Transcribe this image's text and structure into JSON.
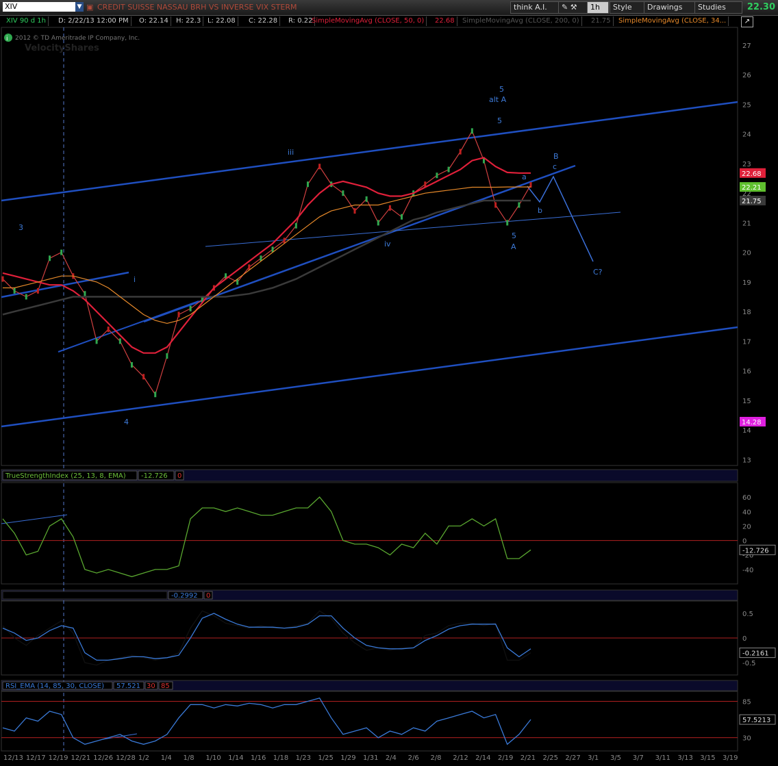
{
  "toolbar": {
    "symbol": "XIV",
    "description": "CREDIT SUISSE NASSAU BRH VS INVERSE VIX STERM",
    "think_label": "think A.I.",
    "interval_label": "1h",
    "style_label": "Style",
    "drawings_label": "Drawings",
    "studies_label": "Studies",
    "last_price": "22.30"
  },
  "quote": {
    "symbol_period": "XIV 90 d 1h",
    "date": "D: 2/22/13 12:00 PM",
    "open": "O: 22.14",
    "high": "H: 22.3",
    "low": "L: 22.08",
    "close": "C: 22.28",
    "range": "R: 0.22",
    "sma50": "SimpleMovingAvg (CLOSE, 50, 0)",
    "sma50_val": "22.68",
    "sma200": "SimpleMovingAvg (CLOSE, 200, 0)",
    "sma200_val": "21.75",
    "sma34": "SimpleMovingAvg (CLOSE, 34...",
    "copyright": "2012 © TD Ameritrade IP Company, Inc.",
    "watermark": "VelocityShares"
  },
  "chart_data": [
    {
      "type": "line",
      "panel": "price",
      "ylim": [
        12.8,
        27.6
      ],
      "y_ticks": [
        13,
        14,
        15,
        16,
        17,
        18,
        19,
        20,
        21,
        22,
        23,
        24,
        25,
        26,
        27
      ],
      "price_badges": [
        {
          "label": "22.68",
          "value": 22.68,
          "color": "#e0203a"
        },
        {
          "label": "22.21",
          "value": 22.21,
          "color": "#5fbf2f"
        },
        {
          "label": "21.75",
          "value": 21.75,
          "color": "#3a3a3a"
        },
        {
          "label": "14.28",
          "value": 14.28,
          "color": "#e020e0"
        }
      ],
      "x_labels": [
        "12/13",
        "12/17",
        "12/19",
        "12/21",
        "12/26",
        "12/28",
        "1/2",
        "1/4",
        "1/8",
        "1/10",
        "1/14",
        "1/16",
        "1/18",
        "1/23",
        "1/25",
        "1/29",
        "1/31",
        "2/4",
        "2/6",
        "2/8",
        "2/12",
        "2/14",
        "2/19",
        "2/21",
        "2/25",
        "2/27",
        "3/1",
        "3/5",
        "3/7",
        "3/11",
        "3/13",
        "3/15",
        "3/19"
      ],
      "series": [
        {
          "values": [
            19.1,
            18.7,
            18.5,
            18.7,
            19.8,
            20.0,
            19.2,
            18.6,
            17.0,
            17.4,
            17.0,
            16.2,
            15.8,
            15.2,
            16.5,
            17.9,
            18.1,
            18.4,
            18.8,
            19.2,
            19.0,
            19.5,
            19.8,
            20.1,
            20.4,
            20.9,
            22.3,
            22.9,
            22.3,
            22.0,
            21.4,
            21.8,
            21.0,
            21.5,
            21.2,
            22.0,
            22.3,
            22.6,
            22.8,
            23.4,
            24.1,
            23.1,
            21.6,
            21.0,
            21.6,
            22.28
          ]
        },
        {
          "name": "SimpleMovingAvg (CLOSE, 50, 0)",
          "values": [
            19.3,
            19.2,
            19.1,
            19.0,
            18.9,
            18.9,
            18.7,
            18.4,
            18.0,
            17.6,
            17.2,
            16.8,
            16.6,
            16.6,
            16.8,
            17.3,
            17.8,
            18.3,
            18.8,
            19.1,
            19.4,
            19.7,
            20.0,
            20.3,
            20.7,
            21.1,
            21.6,
            22.0,
            22.3,
            22.4,
            22.3,
            22.2,
            22.0,
            21.9,
            21.9,
            22.0,
            22.2,
            22.4,
            22.6,
            22.8,
            23.1,
            23.2,
            22.9,
            22.7,
            22.68,
            22.68
          ]
        },
        {
          "name": "SimpleMovingAvg (CLOSE, 200, 0)",
          "values": [
            17.9,
            18.0,
            18.1,
            18.2,
            18.3,
            18.4,
            18.5,
            18.5,
            18.5,
            18.5,
            18.5,
            18.5,
            18.5,
            18.5,
            18.5,
            18.5,
            18.5,
            18.5,
            18.5,
            18.5,
            18.55,
            18.6,
            18.7,
            18.8,
            18.95,
            19.1,
            19.3,
            19.5,
            19.7,
            19.9,
            20.1,
            20.3,
            20.5,
            20.7,
            20.9,
            21.1,
            21.2,
            21.35,
            21.45,
            21.55,
            21.65,
            21.75,
            21.75,
            21.75,
            21.75,
            21.75
          ]
        },
        {
          "name": "SimpleMovingAvg (CLOSE, 34...",
          "values": [
            18.8,
            18.8,
            18.9,
            19.0,
            19.1,
            19.2,
            19.2,
            19.1,
            19.0,
            18.8,
            18.5,
            18.2,
            17.9,
            17.7,
            17.6,
            17.7,
            17.9,
            18.2,
            18.5,
            18.8,
            19.1,
            19.4,
            19.7,
            20.0,
            20.3,
            20.6,
            20.9,
            21.2,
            21.4,
            21.5,
            21.6,
            21.6,
            21.6,
            21.7,
            21.8,
            21.9,
            22.0,
            22.05,
            22.1,
            22.15,
            22.2,
            22.2,
            22.2,
            22.21,
            22.21,
            22.21
          ]
        }
      ],
      "wave_labels": [
        "3",
        "4",
        "i",
        "iii",
        "iv",
        "5",
        "alt A",
        "5",
        "5",
        "A",
        "a",
        "b",
        "B",
        "c",
        "C?"
      ]
    },
    {
      "type": "line",
      "panel": "indicator",
      "title": "TrueStrengthIndex (25, 13, 8, EMA)",
      "value_label": "-12.726",
      "extra_label": "0",
      "ylim": [
        -60,
        80
      ],
      "y_ticks": [
        60,
        40,
        20,
        0,
        -20,
        -40
      ],
      "current_badge": "-12.726",
      "series": [
        {
          "values": [
            30,
            10,
            -20,
            -15,
            20,
            30,
            5,
            -40,
            -45,
            -40,
            -45,
            -50,
            -45,
            -40,
            -40,
            -35,
            30,
            45,
            45,
            40,
            45,
            40,
            35,
            35,
            40,
            45,
            45,
            60,
            40,
            0,
            -5,
            -5,
            -10,
            -20,
            -5,
            -10,
            10,
            -5,
            20,
            20,
            30,
            20,
            30,
            -25,
            -25,
            -13
          ]
        }
      ]
    },
    {
      "type": "line",
      "panel": "indicator",
      "title": "",
      "value_label": "-0.2992",
      "extra_label": "0",
      "ylim": [
        -0.75,
        0.75
      ],
      "y_ticks": [
        0.5,
        0,
        -0.5
      ],
      "current_badge": "-0.2161",
      "series": [
        {
          "values": [
            0.25,
            0.0,
            -0.15,
            0.05,
            0.2,
            0.35,
            0.1,
            -0.5,
            -0.55,
            -0.45,
            -0.4,
            -0.35,
            -0.4,
            -0.45,
            -0.4,
            -0.3,
            0.2,
            0.55,
            0.45,
            0.3,
            0.25,
            0.2,
            0.25,
            0.2,
            0.2,
            0.25,
            0.3,
            0.55,
            0.4,
            0.1,
            -0.1,
            -0.25,
            -0.2,
            -0.25,
            -0.2,
            -0.2,
            0.05,
            0.1,
            0.25,
            0.3,
            0.3,
            0.25,
            0.3,
            -0.45,
            -0.45,
            -0.3
          ]
        },
        {
          "values": [
            0.2,
            0.1,
            -0.05,
            0.0,
            0.15,
            0.25,
            0.2,
            -0.3,
            -0.45,
            -0.45,
            -0.42,
            -0.38,
            -0.38,
            -0.42,
            -0.4,
            -0.35,
            0.0,
            0.4,
            0.5,
            0.38,
            0.28,
            0.22,
            0.22,
            0.22,
            0.2,
            0.22,
            0.28,
            0.45,
            0.45,
            0.2,
            0.0,
            -0.15,
            -0.2,
            -0.22,
            -0.22,
            -0.2,
            -0.05,
            0.05,
            0.18,
            0.25,
            0.28,
            0.28,
            0.28,
            -0.2,
            -0.38,
            -0.22
          ]
        }
      ]
    },
    {
      "type": "line",
      "panel": "indicator",
      "title": "RSI_EMA (14, 85, 30, CLOSE)",
      "value_label": "57.521",
      "extra_label": "30",
      "extra_label2": "85",
      "ylim": [
        10,
        100
      ],
      "y_ticks": [
        85,
        30
      ],
      "current_badge": "57.5213",
      "series": [
        {
          "values": [
            45,
            40,
            60,
            55,
            70,
            65,
            30,
            20,
            25,
            30,
            35,
            25,
            20,
            25,
            35,
            60,
            80,
            80,
            75,
            80,
            78,
            82,
            80,
            75,
            80,
            80,
            85,
            90,
            60,
            35,
            40,
            45,
            30,
            40,
            35,
            45,
            40,
            55,
            60,
            65,
            70,
            60,
            65,
            20,
            35,
            57.5
          ]
        }
      ]
    }
  ]
}
